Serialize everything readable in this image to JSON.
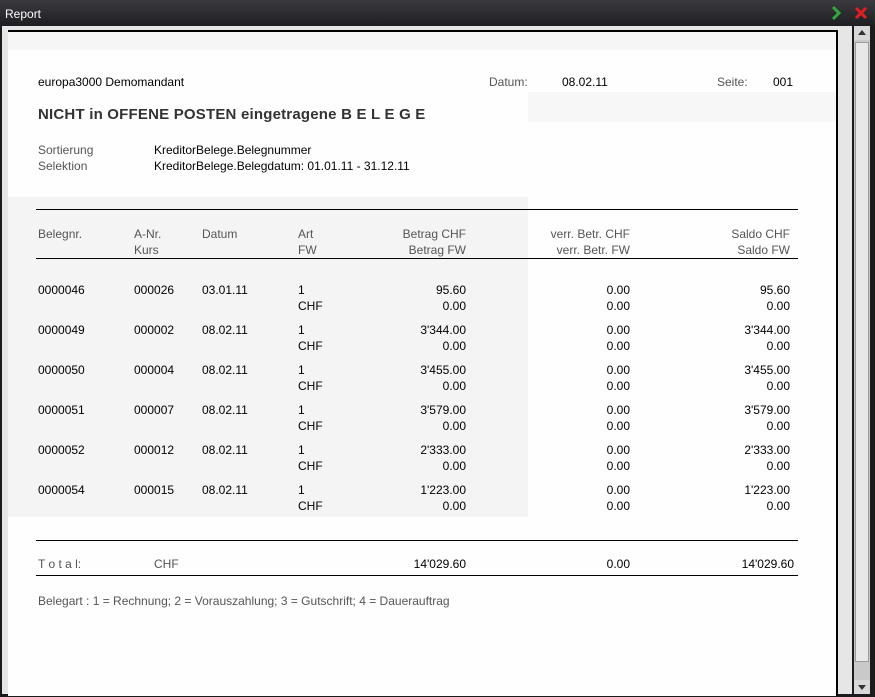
{
  "window": {
    "title": "Report",
    "ghost_text": "",
    "next_icon": "chevron-right-icon",
    "close_icon": "close-icon",
    "accent_green": "#2faa3a",
    "accent_red": "#e02020"
  },
  "report": {
    "company": "europa3000 Demomandant",
    "date_label": "Datum:",
    "date_value": "08.02.11",
    "page_label": "Seite:",
    "page_value": "001",
    "title": "NICHT in OFFENE POSTEN eingetragene B E L E G E",
    "sort_label": "Sortierung",
    "sort_value": "KreditorBelege.Belegnummer",
    "sel_label": "Selektion",
    "sel_value": "KreditorBelege.Belegdatum: 01.01.11 - 31.12.11",
    "headers": {
      "belegnr": "Belegnr.",
      "anr": "A-Nr.",
      "kurs": "Kurs",
      "datum": "Datum",
      "art": "Art",
      "fw": "FW",
      "betrag_chf": "Betrag CHF",
      "betrag_fw": "Betrag FW",
      "verr_chf": "verr. Betr. CHF",
      "verr_fw": "verr. Betr. FW",
      "saldo_chf": "Saldo CHF",
      "saldo_fw": "Saldo FW"
    },
    "rows": [
      {
        "belegnr": "0000046",
        "anr": "000026",
        "datum": "03.01.11",
        "art": "1",
        "fw": "CHF",
        "betrag": "95.60",
        "betrag_fw": "0.00",
        "verr": "0.00",
        "verr_fw": "0.00",
        "saldo": "95.60",
        "saldo_fw": "0.00"
      },
      {
        "belegnr": "0000049",
        "anr": "000002",
        "datum": "08.02.11",
        "art": "1",
        "fw": "CHF",
        "betrag": "3'344.00",
        "betrag_fw": "0.00",
        "verr": "0.00",
        "verr_fw": "0.00",
        "saldo": "3'344.00",
        "saldo_fw": "0.00"
      },
      {
        "belegnr": "0000050",
        "anr": "000004",
        "datum": "08.02.11",
        "art": "1",
        "fw": "CHF",
        "betrag": "3'455.00",
        "betrag_fw": "0.00",
        "verr": "0.00",
        "verr_fw": "0.00",
        "saldo": "3'455.00",
        "saldo_fw": "0.00"
      },
      {
        "belegnr": "0000051",
        "anr": "000007",
        "datum": "08.02.11",
        "art": "1",
        "fw": "CHF",
        "betrag": "3'579.00",
        "betrag_fw": "0.00",
        "verr": "0.00",
        "verr_fw": "0.00",
        "saldo": "3'579.00",
        "saldo_fw": "0.00"
      },
      {
        "belegnr": "0000052",
        "anr": "000012",
        "datum": "08.02.11",
        "art": "1",
        "fw": "CHF",
        "betrag": "2'333.00",
        "betrag_fw": "0.00",
        "verr": "0.00",
        "verr_fw": "0.00",
        "saldo": "2'333.00",
        "saldo_fw": "0.00"
      },
      {
        "belegnr": "0000054",
        "anr": "000015",
        "datum": "08.02.11",
        "art": "1",
        "fw": "CHF",
        "betrag": "1'223.00",
        "betrag_fw": "0.00",
        "verr": "0.00",
        "verr_fw": "0.00",
        "saldo": "1'223.00",
        "saldo_fw": "0.00"
      }
    ],
    "total": {
      "label": "T o t a l:",
      "currency": "CHF",
      "betrag": "14'029.60",
      "verr": "0.00",
      "saldo": "14'029.60"
    },
    "legend": "Belegart : 1 = Rechnung; 2 = Vorauszahlung; 3 = Gutschrift; 4 = Dauerauftrag"
  }
}
